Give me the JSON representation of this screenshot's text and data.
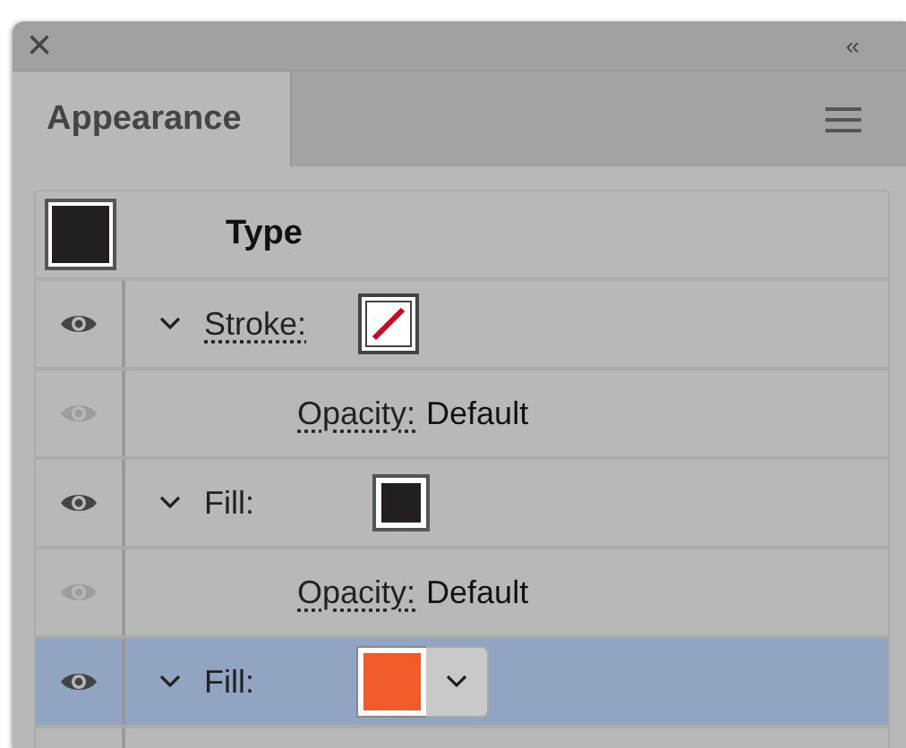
{
  "panel": {
    "close": "×",
    "collapse": "‹‹"
  },
  "tabs": [
    {
      "label": "Appearance",
      "selected": true
    }
  ],
  "header": {
    "title": "Type",
    "color": "#231f20"
  },
  "rows": [
    {
      "kind": "attribute",
      "label": "Stroke:",
      "link": true,
      "expanded": true,
      "eye_dimmed": false,
      "selected": false,
      "no_color": true,
      "dropdown": false
    },
    {
      "kind": "opacity",
      "label": "Opacity:",
      "value": "Default",
      "eye_dimmed": true,
      "selected": false
    },
    {
      "kind": "attribute",
      "label": "Fill:",
      "link": false,
      "expanded": true,
      "eye_dimmed": false,
      "selected": false,
      "no_color": false,
      "color": "#231f20",
      "dropdown": false
    },
    {
      "kind": "opacity",
      "label": "Opacity:",
      "value": "Default",
      "eye_dimmed": true,
      "selected": false
    },
    {
      "kind": "attribute",
      "label": "Fill:",
      "link": false,
      "expanded": true,
      "eye_dimmed": false,
      "selected": true,
      "no_color": false,
      "color": "#f15a29",
      "dropdown": true
    }
  ]
}
